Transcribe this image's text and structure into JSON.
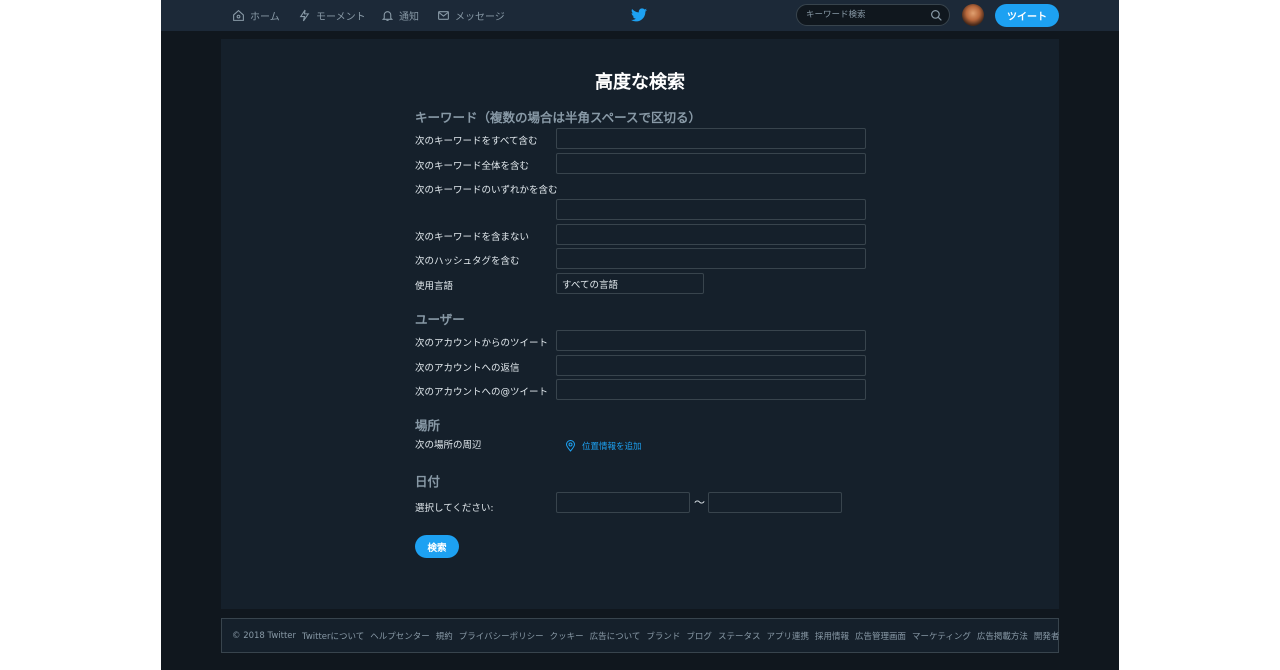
{
  "nav": {
    "home": "ホーム",
    "moments": "モーメント",
    "notifications": "通知",
    "messages": "メッセージ",
    "search_placeholder": "キーワード検索",
    "tweet_button": "ツイート"
  },
  "page": {
    "title": "高度な検索",
    "submit": "検索"
  },
  "sections": {
    "keywords": {
      "title": "キーワード（複数の場合は半角スペースで区切る）",
      "all_words": "次のキーワードをすべて含む",
      "exact_phrase": "次のキーワード全体を含む",
      "any_words": "次のキーワードのいずれかを含む",
      "none_words": "次のキーワードを含まない",
      "hashtags": "次のハッシュタグを含む",
      "language_label": "使用言語",
      "language_value": "すべての言語"
    },
    "users": {
      "title": "ユーザー",
      "from": "次のアカウントからのツイート",
      "to": "次のアカウントへの返信",
      "mentioning": "次のアカウントへの@ツイート"
    },
    "places": {
      "title": "場所",
      "near": "次の場所の周辺",
      "add_location": "位置情報を追加"
    },
    "dates": {
      "title": "日付",
      "select": "選択してください:",
      "separator": "〜"
    }
  },
  "footer": {
    "copyright": "© 2018 Twitter",
    "links": [
      "Twitterについて",
      "ヘルプセンター",
      "規約",
      "プライバシーポリシー",
      "クッキー",
      "広告について",
      "ブランド",
      "ブログ",
      "ステータス",
      "アプリ連携",
      "採用情報",
      "広告管理画面",
      "マーケティング",
      "広告掲載方法",
      "開発者"
    ]
  },
  "colors": {
    "accent": "#1da1f2",
    "background": "#10171e",
    "panel": "#15202b",
    "nav": "#1c2938",
    "muted_text": "#8899a6"
  }
}
